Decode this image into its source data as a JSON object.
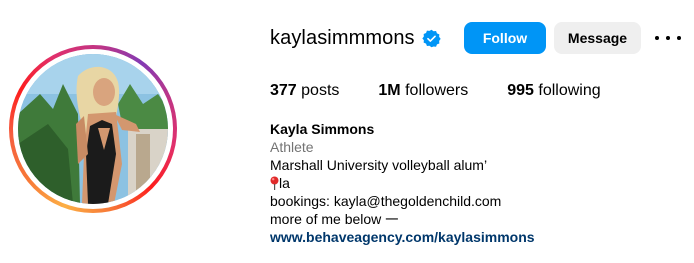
{
  "profile": {
    "username": "kaylasimmmons",
    "verified": true,
    "follow_label": "Follow",
    "message_label": "Message",
    "stats": {
      "posts_count": "377",
      "posts_label": "posts",
      "followers_count": "1M",
      "followers_label": "followers",
      "following_count": "995",
      "following_label": "following"
    },
    "bio": {
      "name": "Kayla Simmons",
      "category": "Athlete",
      "line1": "Marshall University volleyball alum’",
      "line2": "la",
      "line3": "bookings: kayla@thegoldenchild.com",
      "line4": "more of me below 𑁋",
      "link": "www.behaveagency.com/kaylasimmons"
    }
  },
  "colors": {
    "follow_bg": "#0095f6",
    "message_bg": "#efefef",
    "link": "#00376b",
    "category": "#737373",
    "verified": "#0095f6"
  },
  "icons": {
    "verified": "verified-badge-icon",
    "more": "more-options-icon",
    "pin": "round-pushpin-icon"
  }
}
